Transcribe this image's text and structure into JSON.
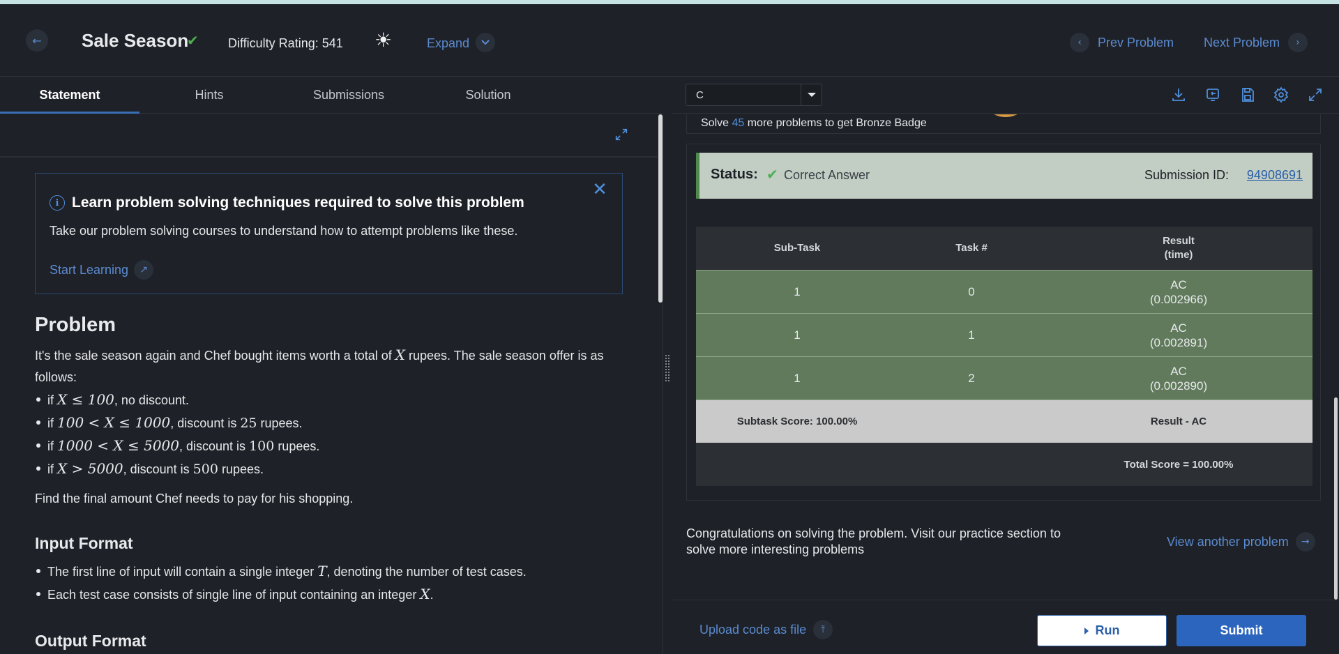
{
  "header": {
    "back_icon": "arrow-left-icon",
    "title": "Sale Season",
    "solved_icon": "check-icon",
    "difficulty": "Difficulty Rating: 541",
    "theme_icon": "sun-icon",
    "expand_label": "Expand",
    "prev_label": "Prev Problem",
    "next_label": "Next Problem"
  },
  "tabs": [
    {
      "label": "Statement",
      "active": true
    },
    {
      "label": "Hints"
    },
    {
      "label": "Submissions"
    },
    {
      "label": "Solution"
    }
  ],
  "editor": {
    "language": "C",
    "tool_icons": [
      "download-icon",
      "reset-icon",
      "save-icon",
      "settings-icon",
      "fullscreen-icon"
    ]
  },
  "learn_box": {
    "title": "Learn problem solving techniques required to solve this problem",
    "text": "Take our problem solving courses to understand how to attempt problems like these.",
    "link": "Start Learning"
  },
  "problem": {
    "heading": "Problem",
    "intro_1": "It's the sale season again and Chef bought items worth a total of ",
    "intro_x": "X",
    "intro_2": " rupees. The sale season offer is as follows:",
    "rules": [
      {
        "pre": "if ",
        "math": "X ≤ 100",
        "post": ", no discount."
      },
      {
        "pre": "if ",
        "math": "100 < X ≤ 1000",
        "post": ", discount is ",
        "num": "25",
        "tail": " rupees."
      },
      {
        "pre": "if ",
        "math": "1000 < X ≤ 5000",
        "post": ", discount is ",
        "num": "100",
        "tail": " rupees."
      },
      {
        "pre": "if ",
        "math": "X > 5000",
        "post": ", discount is ",
        "num": "500",
        "tail": " rupees."
      }
    ],
    "find": "Find the final amount Chef needs to pay for his shopping.",
    "input_heading": "Input Format",
    "input_items": [
      {
        "pre": "The first line of input will contain a single integer ",
        "math": "T",
        "post": ", denoting the number of test cases."
      },
      {
        "pre": "Each test case consists of single line of input containing an integer ",
        "math": "X",
        "post": "."
      }
    ],
    "output_heading": "Output Format"
  },
  "badge": {
    "pre": "Solve ",
    "count": "45",
    "post": " more problems to get Bronze Badge"
  },
  "status": {
    "label": "Status:",
    "value": "Correct Answer",
    "submission_label": "Submission ID:",
    "submission_id": "94908691"
  },
  "results": {
    "headers": [
      "Sub-Task",
      "Task #",
      "Result\n(time)"
    ],
    "rows": [
      {
        "subtask": "1",
        "task": "0",
        "result": "AC",
        "time": "(0.002966)"
      },
      {
        "subtask": "1",
        "task": "1",
        "result": "AC",
        "time": "(0.002891)"
      },
      {
        "subtask": "1",
        "task": "2",
        "result": "AC",
        "time": "(0.002890)"
      }
    ],
    "subtask_score": "Subtask Score: 100.00%",
    "result_summary": "Result - AC",
    "total_score": "Total Score = 100.00%"
  },
  "congrats": {
    "text": "Congratulations on solving the problem. Visit our practice section to solve more interesting problems",
    "link": "View another problem"
  },
  "bottom": {
    "upload_label": "Upload code as file",
    "run_label": "Run",
    "submit_label": "Submit"
  },
  "colors": {
    "accent": "#5b8bd0",
    "success": "#4caf50",
    "ac_row": "#607a5b",
    "submit": "#2b65bd"
  }
}
